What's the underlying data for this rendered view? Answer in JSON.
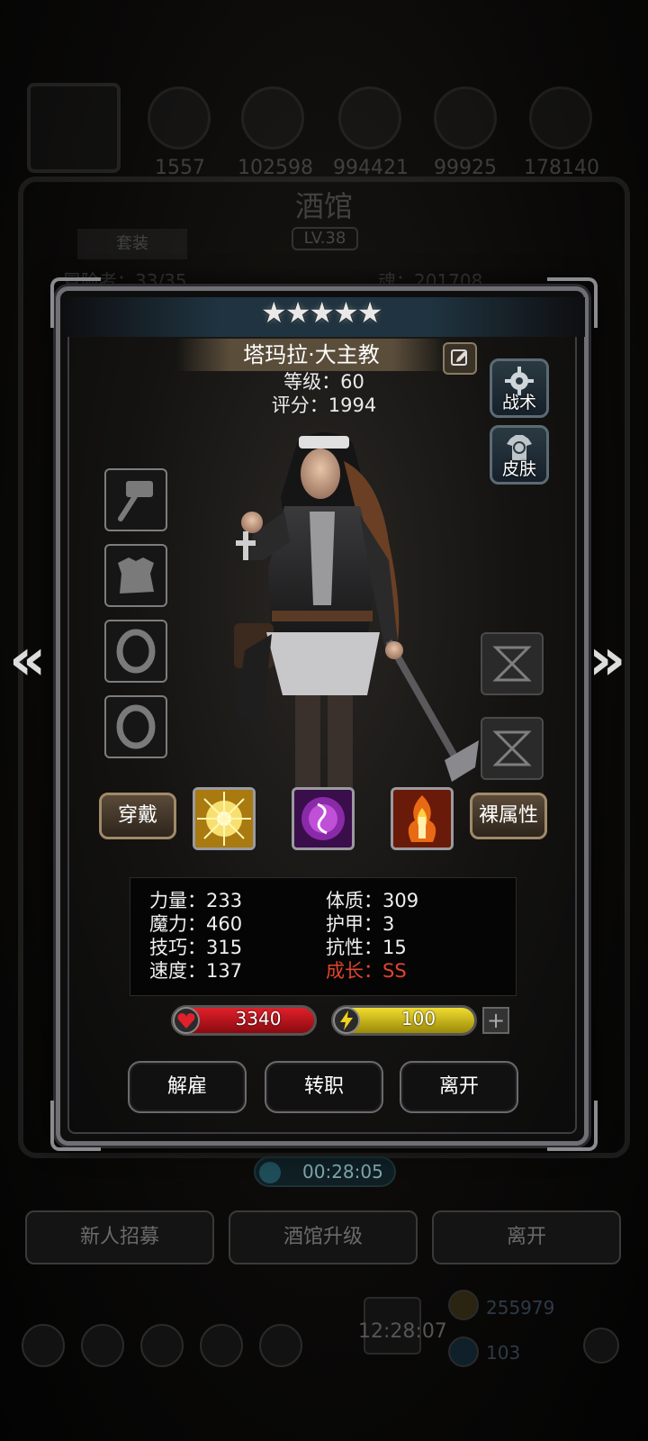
{
  "background": {
    "resources": [
      "1557",
      "102598",
      "994421",
      "99925",
      "178140"
    ],
    "title": "酒馆",
    "level": "LV.38",
    "tab": "套装",
    "line_left": "冒险者：33/35",
    "line_right": "魂：201708",
    "timer": "00:28:05",
    "bottom_buttons": [
      "新人招募",
      "酒馆升级",
      "离开"
    ],
    "clock": "12:28:07",
    "gold": "255979",
    "gems": "103"
  },
  "hero": {
    "stars": "★★★★★",
    "name": "塔玛拉·大主教",
    "level_line": "等级：60",
    "score_line": "评分：1994"
  },
  "side_buttons": {
    "tactics": "战术",
    "skin": "皮肤"
  },
  "equip_buttons": {
    "wear": "穿戴",
    "bare_attr": "裸属性"
  },
  "stats": {
    "strength": "力量：233",
    "magic": "魔力：460",
    "skill": "技巧：315",
    "speed": "速度：137",
    "constitution": "体质：309",
    "armor": "护甲：3",
    "resistance": "抗性：15",
    "growth": "成长：SS"
  },
  "bars": {
    "hp": "3340",
    "energy": "100",
    "plus": "+"
  },
  "actions": {
    "dismiss": "解雇",
    "transfer": "转职",
    "leave": "离开"
  },
  "colors": {
    "growth_red": "#e0442c",
    "hp_red": "#c8141c",
    "energy_yellow": "#d8c21a"
  }
}
